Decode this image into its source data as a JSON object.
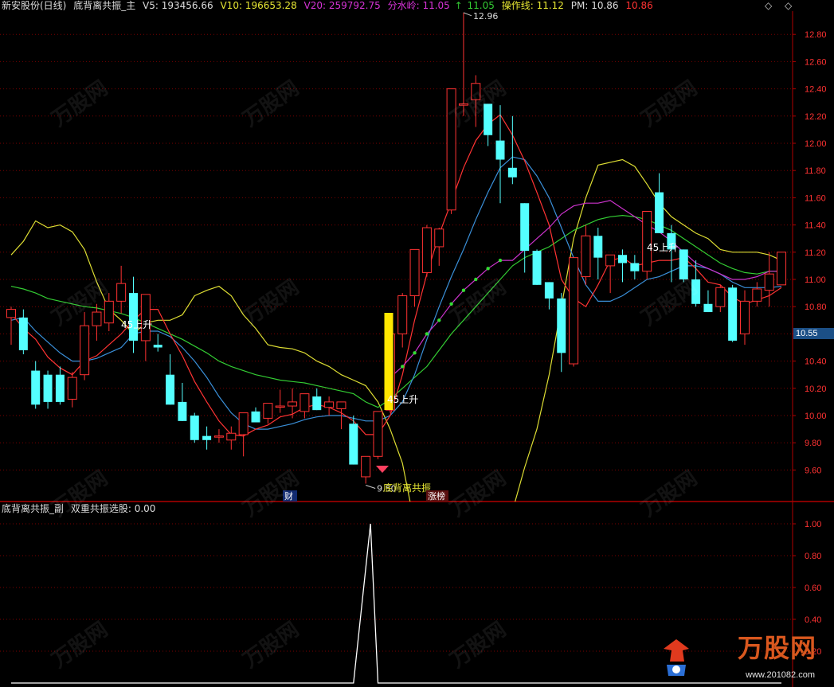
{
  "main_header": {
    "stock": "新安股份(日线)",
    "indicator": "底背离共振_主",
    "v5": "V5: 193456.66",
    "v10": "V10: 196653.28",
    "v20": "V20: 259792.75",
    "fenshuiling": "分水岭: 11.05",
    "fenshuiling_arrow": "↑",
    "fenshuiling_val2": "11.05",
    "caozuo": "操作线: 11.12",
    "pm": "PM: 10.86",
    "extra": "10.86"
  },
  "sub_header": {
    "indicator": "底背离共振_副",
    "value_text": "双重共振选股: 0.00"
  },
  "window_controls": {
    "diamond": "◇",
    "close": "◇"
  },
  "current_price_tag": "10.55",
  "annotations": {
    "high_label": "12.96",
    "low_label": "9.50",
    "rise_1": "45上升",
    "rise_2": "45上升",
    "rise_3": "45上升",
    "diverge": "底背离共振",
    "cai": "财",
    "zhangbang": "涨榜"
  },
  "watermark": {
    "text": "万股网",
    "site": "www.201082.com"
  },
  "colors": {
    "up": "#ff3232",
    "down": "#54ffff",
    "grid": "#7a0000",
    "ma5": "#ff3333",
    "ma10": "#3a8fd8",
    "ma20": "#33cc33",
    "fenshuiling": "#dddd33",
    "pm": "#cc33cc"
  },
  "chart_data": [
    {
      "type": "candlestick",
      "title": "底背离共振_主",
      "ylim": [
        9.42,
        12.96
      ],
      "yticks": [
        "12.80",
        "12.60",
        "12.40",
        "12.20",
        "12.00",
        "11.80",
        "11.60",
        "11.40",
        "11.20",
        "11.00",
        "10.80",
        "10.60",
        "10.40",
        "10.20",
        "10.00",
        "9.80",
        "9.60"
      ],
      "candles": [
        [
          10.72,
          10.8,
          10.52,
          10.78
        ],
        [
          10.72,
          10.78,
          10.45,
          10.48
        ],
        [
          10.33,
          10.4,
          10.05,
          10.08
        ],
        [
          10.3,
          10.33,
          10.05,
          10.1
        ],
        [
          10.3,
          10.36,
          10.08,
          10.1
        ],
        [
          10.12,
          10.32,
          10.06,
          10.28
        ],
        [
          10.3,
          10.76,
          10.26,
          10.66
        ],
        [
          10.66,
          10.82,
          10.55,
          10.76
        ],
        [
          10.68,
          10.9,
          10.62,
          10.84
        ],
        [
          10.84,
          11.1,
          10.75,
          10.97
        ],
        [
          10.9,
          11.02,
          10.46,
          10.55
        ],
        [
          10.55,
          10.82,
          10.4,
          10.89
        ],
        [
          10.52,
          10.6,
          10.47,
          10.5
        ],
        [
          10.3,
          10.45,
          10.1,
          10.08
        ],
        [
          10.1,
          10.24,
          9.98,
          9.96
        ],
        [
          10.0,
          10.02,
          9.8,
          9.82
        ],
        [
          9.85,
          9.92,
          9.75,
          9.82
        ],
        [
          9.85,
          9.9,
          9.8,
          9.85
        ],
        [
          9.82,
          9.92,
          9.75,
          9.87
        ],
        [
          9.86,
          10.02,
          9.7,
          10.02
        ],
        [
          10.03,
          10.06,
          9.95,
          9.95
        ],
        [
          9.98,
          10.09,
          9.94,
          10.09
        ],
        [
          10.07,
          10.19,
          10.02,
          10.07
        ],
        [
          10.07,
          10.2,
          9.98,
          10.1
        ],
        [
          10.03,
          10.16,
          9.98,
          10.16
        ],
        [
          10.14,
          10.2,
          10.04,
          10.04
        ],
        [
          10.06,
          10.14,
          10.0,
          10.1
        ],
        [
          10.05,
          10.08,
          9.9,
          10.1
        ],
        [
          9.94,
          10.0,
          9.68,
          9.64
        ],
        [
          9.55,
          9.7,
          9.5,
          9.7
        ],
        [
          9.7,
          10.02,
          9.68,
          10.03
        ],
        [
          10.04,
          10.46,
          10.02,
          10.6
        ],
        [
          10.6,
          10.9,
          10.5,
          10.88
        ],
        [
          10.88,
          11.2,
          10.8,
          11.22
        ],
        [
          11.05,
          11.4,
          11.02,
          11.38
        ],
        [
          11.24,
          11.38,
          11.1,
          11.37
        ],
        [
          11.51,
          12.0,
          11.48,
          12.4
        ],
        [
          12.28,
          12.96,
          12.2,
          12.29
        ],
        [
          12.32,
          12.5,
          12.12,
          12.44
        ],
        [
          12.29,
          12.25,
          11.98,
          12.06
        ],
        [
          12.02,
          12.28,
          11.56,
          11.88
        ],
        [
          11.82,
          12.2,
          11.7,
          11.75
        ],
        [
          11.56,
          11.5,
          11.05,
          11.21
        ],
        [
          11.21,
          11.22,
          10.96,
          10.96
        ],
        [
          10.98,
          10.98,
          10.78,
          10.86
        ],
        [
          10.86,
          10.9,
          10.32,
          10.46
        ],
        [
          10.38,
          11.0,
          10.36,
          11.16
        ],
        [
          11.02,
          11.4,
          10.96,
          11.32
        ],
        [
          11.32,
          11.38,
          11.0,
          11.16
        ],
        [
          11.1,
          11.14,
          10.9,
          11.18
        ],
        [
          11.18,
          11.22,
          10.98,
          11.12
        ],
        [
          11.12,
          11.18,
          11.0,
          11.06
        ],
        [
          11.06,
          11.33,
          11.0,
          11.5
        ],
        [
          11.64,
          11.78,
          11.38,
          11.34
        ],
        [
          11.34,
          11.4,
          10.98,
          11.22
        ],
        [
          11.22,
          11.22,
          10.98,
          11.0
        ],
        [
          11.0,
          11.14,
          10.8,
          10.82
        ],
        [
          10.82,
          10.92,
          10.76,
          10.76
        ],
        [
          10.8,
          10.96,
          10.76,
          10.94
        ],
        [
          10.94,
          10.96,
          10.54,
          10.55
        ],
        [
          10.6,
          10.92,
          10.52,
          10.84
        ],
        [
          10.84,
          10.98,
          10.8,
          10.93
        ],
        [
          10.92,
          11.2,
          10.8,
          11.04
        ],
        [
          10.96,
          11.2,
          10.96,
          11.2
        ]
      ],
      "lines": {
        "ma5": [
          10.75,
          10.64,
          10.56,
          10.43,
          10.35,
          10.3,
          10.4,
          10.44,
          10.52,
          10.6,
          10.7,
          10.78,
          10.78,
          10.6,
          10.44,
          10.25,
          10.1,
          9.96,
          9.86,
          9.85,
          9.9,
          9.93,
          9.99,
          10.01,
          10.06,
          10.08,
          10.06,
          10.02,
          9.96,
          9.86,
          9.86,
          10.0,
          10.3,
          10.7,
          11.04,
          11.33,
          11.57,
          11.82,
          12.02,
          12.14,
          12.21,
          12.06,
          11.87,
          11.64,
          11.4,
          11.0,
          10.86,
          10.8,
          10.96,
          11.14,
          11.16,
          11.1,
          11.12,
          11.14,
          11.14,
          11.16,
          11.08,
          10.98,
          10.96,
          10.87,
          10.82,
          10.85,
          10.88,
          10.94
        ],
        "ma10": [
          10.7,
          10.72,
          10.62,
          10.54,
          10.46,
          10.4,
          10.4,
          10.42,
          10.46,
          10.5,
          10.6,
          10.62,
          10.62,
          10.58,
          10.5,
          10.4,
          10.28,
          10.14,
          10.02,
          9.94,
          9.9,
          9.9,
          9.92,
          9.94,
          9.97,
          9.99,
          10.0,
          10.0,
          9.98,
          9.96,
          9.96,
          10.0,
          10.1,
          10.3,
          10.56,
          10.8,
          11.02,
          11.22,
          11.44,
          11.64,
          11.82,
          11.9,
          11.88,
          11.76,
          11.6,
          11.38,
          11.16,
          10.96,
          10.84,
          10.84,
          10.88,
          10.94,
          11.0,
          11.02,
          11.06,
          11.1,
          11.1,
          11.08,
          11.04,
          10.98,
          10.94,
          10.94,
          10.94,
          10.95
        ],
        "ma20": [
          10.95,
          10.93,
          10.9,
          10.86,
          10.84,
          10.82,
          10.8,
          10.79,
          10.77,
          10.75,
          10.72,
          10.68,
          10.64,
          10.6,
          10.56,
          10.51,
          10.46,
          10.4,
          10.36,
          10.33,
          10.3,
          10.28,
          10.26,
          10.25,
          10.24,
          10.22,
          10.2,
          10.18,
          10.16,
          10.1,
          10.06,
          10.12,
          10.2,
          10.28,
          10.36,
          10.48,
          10.6,
          10.7,
          10.8,
          10.9,
          11.0,
          11.1,
          11.16,
          11.2,
          11.24,
          11.3,
          11.36,
          11.4,
          11.44,
          11.46,
          11.47,
          11.46,
          11.44,
          11.4,
          11.36,
          11.3,
          11.24,
          11.18,
          11.12,
          11.08,
          11.05,
          11.04,
          11.06,
          11.06
        ],
        "fenshuiling": [
          11.18,
          11.28,
          11.43,
          11.38,
          11.4,
          11.35,
          11.22,
          10.98,
          10.78,
          10.7,
          10.6,
          10.68,
          10.7,
          10.7,
          10.74,
          10.88,
          10.92,
          10.95,
          10.88,
          10.74,
          10.64,
          10.52,
          10.5,
          10.49,
          10.46,
          10.4,
          10.36,
          10.3,
          10.26,
          10.22,
          10.1,
          9.9,
          9.65,
          9.2,
          8.9,
          8.7,
          8.5,
          8.4,
          8.3,
          8.7,
          9.0,
          9.3,
          9.62,
          9.9,
          10.3,
          10.8,
          11.3,
          11.6,
          11.84,
          11.86,
          11.88,
          11.83,
          11.7,
          11.56,
          11.46,
          11.4,
          11.34,
          11.3,
          11.22,
          11.2,
          11.2,
          11.2,
          11.18,
          11.14
        ],
        "pm": [
          null,
          null,
          null,
          null,
          null,
          null,
          null,
          null,
          null,
          null,
          null,
          null,
          null,
          null,
          null,
          null,
          null,
          null,
          null,
          null,
          null,
          null,
          null,
          null,
          null,
          null,
          null,
          null,
          null,
          null,
          null,
          10.28,
          10.36,
          10.46,
          10.6,
          10.7,
          10.82,
          10.92,
          11.0,
          11.08,
          11.14,
          11.14,
          11.22,
          11.3,
          11.38,
          11.48,
          11.54,
          11.56,
          11.56,
          11.58,
          11.52,
          11.46,
          11.4,
          11.35,
          11.28,
          11.2,
          11.12,
          11.08,
          11.04,
          11.0,
          11.0,
          11.02,
          11.06,
          11.06
        ]
      }
    },
    {
      "type": "line",
      "title": "底背离共振_副",
      "series": [
        {
          "name": "双重共振选股",
          "values": [
            0,
            0,
            0,
            0,
            0,
            0,
            0,
            0,
            0,
            0,
            0,
            0,
            0,
            0,
            0,
            0,
            0,
            0,
            0,
            0,
            0,
            0,
            0,
            0,
            0,
            0,
            0,
            0,
            0,
            1,
            0,
            0,
            0,
            0,
            0,
            0,
            0,
            0,
            0,
            0,
            0,
            0,
            0,
            0,
            0,
            0,
            0,
            0,
            0,
            0,
            0,
            0,
            0,
            0,
            0,
            0,
            0,
            0,
            0,
            0,
            0,
            0,
            0,
            0
          ]
        }
      ],
      "ylim": [
        0,
        1.05
      ],
      "yticks": [
        "1.00",
        "0.80",
        "0.60",
        "0.40",
        "0.20"
      ]
    }
  ]
}
